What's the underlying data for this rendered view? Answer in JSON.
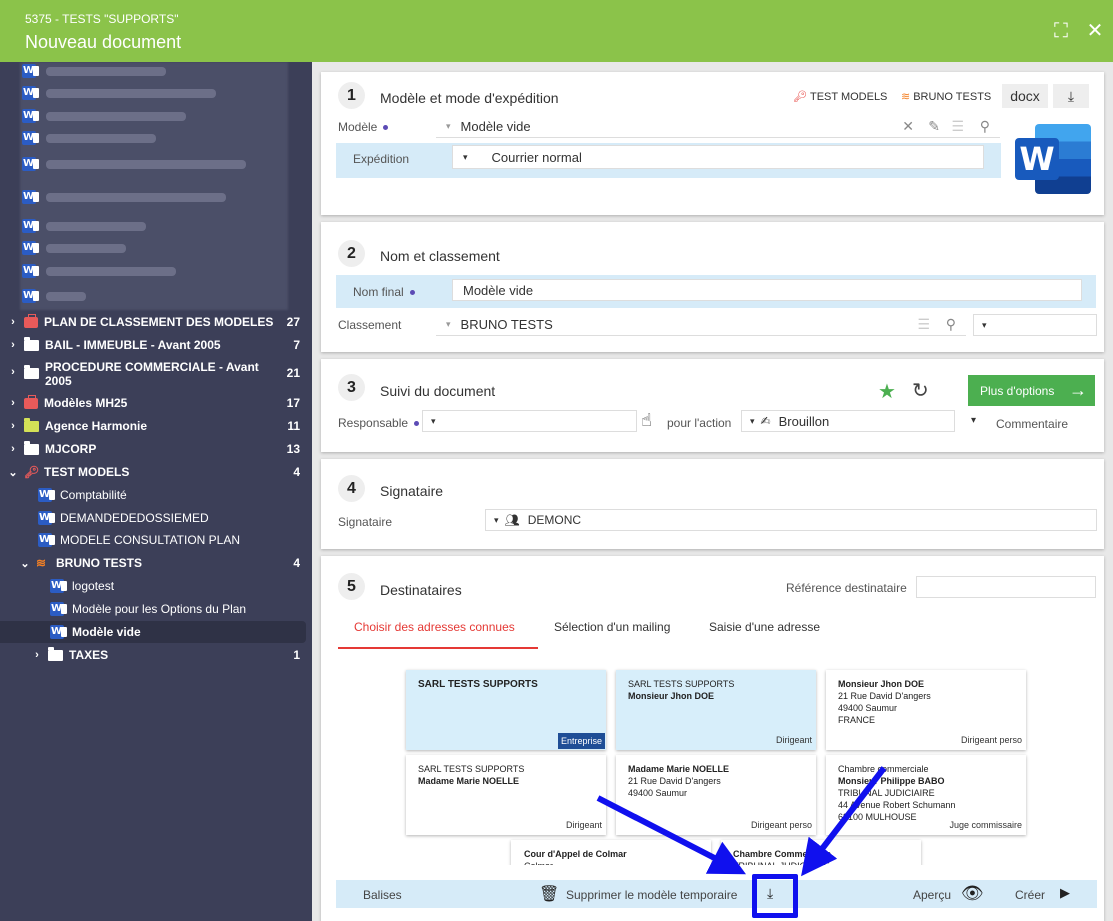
{
  "header": {
    "subtitle": "5375 - TESTS \"SUPPORTS\"",
    "title": "Nouveau document"
  },
  "sidebar": {
    "tree": [
      {
        "label": "PLAN DE CLASSEMENT DES MODELES",
        "count": "27"
      },
      {
        "label": "BAIL - IMMEUBLE - Avant 2005",
        "count": "7"
      },
      {
        "label": "PROCEDURE COMMERCIALE - Avant",
        "label2": "2005",
        "count": "21"
      },
      {
        "label": "Modèles MH25",
        "count": "17"
      },
      {
        "label": "Agence Harmonie",
        "count": "11"
      },
      {
        "label": "MJCORP",
        "count": "13"
      },
      {
        "label": "TEST MODELS",
        "count": "4"
      },
      {
        "label": "Comptabilité"
      },
      {
        "label": "DEMANDEDEDOSSIEMED"
      },
      {
        "label": "MODELE CONSULTATION PLAN"
      },
      {
        "label": "BRUNO TESTS",
        "count": "4"
      },
      {
        "label": "logotest"
      },
      {
        "label": "Modèle pour les Options du Plan"
      },
      {
        "label": "Modèle vide"
      },
      {
        "label": "TAXES",
        "count": "1"
      }
    ]
  },
  "section1": {
    "num": "1",
    "title": "Modèle et mode d'expédition",
    "test_models": "TEST MODELS",
    "bruno_tests": "BRUNO TESTS",
    "docx": "docx",
    "modele_label": "Modèle",
    "modele_value": "Modèle vide",
    "expedition_label": "Expédition",
    "expedition_value": "Courrier normal"
  },
  "section2": {
    "num": "2",
    "title": "Nom et classement",
    "nomfinal_label": "Nom final",
    "nomfinal_value": "Modèle vide",
    "classement_label": "Classement",
    "classement_value": "BRUNO TESTS"
  },
  "section3": {
    "num": "3",
    "title": "Suivi du document",
    "plus_options": "Plus d'options",
    "responsable_label": "Responsable",
    "pour_action": "pour l'action",
    "brouillon": "Brouillon",
    "commentaire": "Commentaire"
  },
  "section4": {
    "num": "4",
    "title": "Signataire",
    "signataire_label": "Signataire",
    "signataire_value": "DEMONC"
  },
  "section5": {
    "num": "5",
    "title": "Destinataires",
    "ref_label": "Référence destinataire",
    "tabs": [
      "Choisir des adresses connues",
      "Sélection d'un mailing",
      "Saisie d'une adresse"
    ],
    "cards": [
      {
        "l1": "SARL TESTS SUPPORTS",
        "l2": "",
        "l3": "",
        "l4": "",
        "badge": "Entreprise"
      },
      {
        "l1": "SARL TESTS SUPPORTS",
        "l2": "Monsieur Jhon DOE",
        "l3": "",
        "l4": "",
        "tag": "Dirigeant"
      },
      {
        "l1": "Monsieur Jhon DOE",
        "l2": "21 Rue David D'angers",
        "l3": "49400 Saumur",
        "l4": "FRANCE",
        "tag": "Dirigeant perso"
      },
      {
        "l1": "SARL TESTS SUPPORTS",
        "l2": "Madame Marie NOELLE",
        "l3": "",
        "l4": "",
        "tag": "Dirigeant"
      },
      {
        "l1": "Madame Marie NOELLE",
        "l2": "21 Rue David D'angers",
        "l3": "49400 Saumur",
        "l4": "",
        "tag": "Dirigeant perso"
      },
      {
        "l1": "Chambre commerciale",
        "l2": "Monsieur Philippe BABO",
        "l3": "TRIBUNAL JUDICIAIRE",
        "l4": "44 Avenue Robert Schumann",
        "l5": "68100 MULHOUSE",
        "tag": "Juge commissaire"
      },
      {
        "l1": "Cour d'Appel de Colmar",
        "l2": "Colmar"
      },
      {
        "l1": "Chambre Commerciale",
        "l2": "TRIBUNAL JUDICIAIRE"
      }
    ]
  },
  "bottom": {
    "balises": "Balises",
    "supprimer": "Supprimer le modèle temporaire",
    "apercu": "Aperçu",
    "creer": "Créer"
  },
  "colors": {
    "header": "#8bc34a",
    "sidebar": "#3c3f58",
    "accent_red": "#e53935",
    "highlight": "#d6ebf8",
    "annotation": "#1010ee",
    "button_green": "#4caf50"
  }
}
